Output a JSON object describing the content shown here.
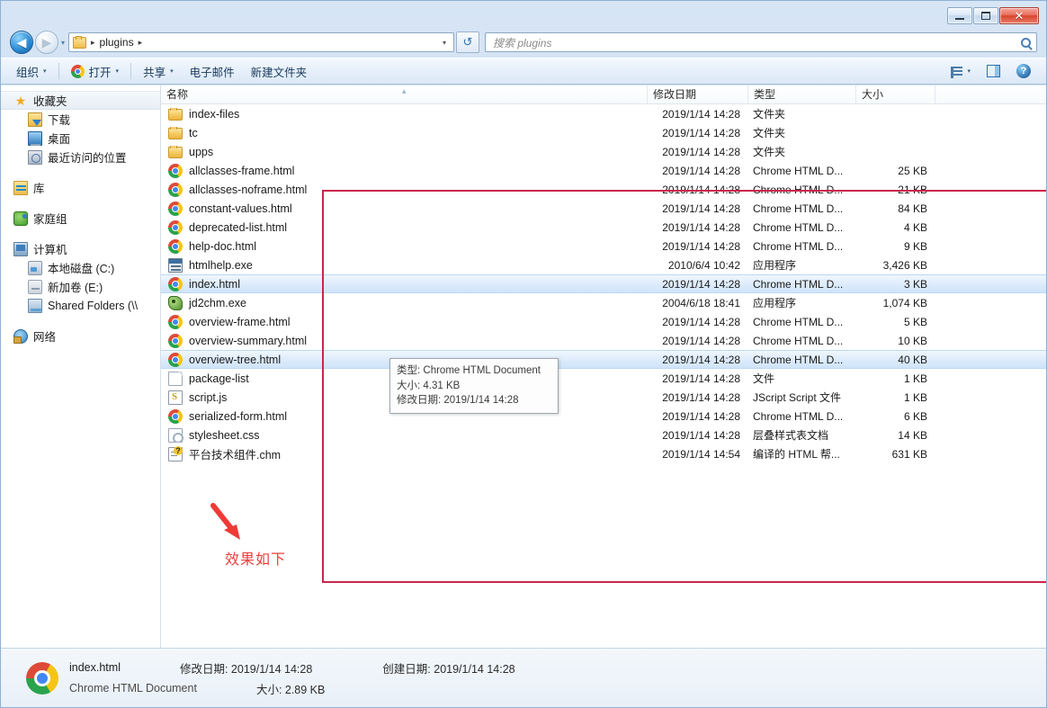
{
  "window": {
    "minimize_label": "–",
    "maximize_label": "□",
    "close_label": "✕"
  },
  "address": {
    "back_glyph": "◀",
    "forward_glyph": "▶",
    "history_glyph": "▾",
    "crumb": "plugins",
    "crumb_sep": "▸",
    "dropdown_glyph": "▾",
    "refresh_glyph": "↺"
  },
  "search": {
    "placeholder": "搜索 plugins"
  },
  "toolbar": {
    "organize": "组织",
    "open": "打开",
    "share": "共享",
    "email": "电子邮件",
    "new_folder": "新建文件夹",
    "caret": "▾",
    "help_glyph": "?"
  },
  "sidebar": {
    "items": [
      {
        "label": "收藏夹",
        "icon": "star-icon",
        "level": 0,
        "selected": true
      },
      {
        "label": "下载",
        "icon": "downloads-icon",
        "level": 1,
        "selected": false
      },
      {
        "label": "桌面",
        "icon": "desktop-icon",
        "level": 1,
        "selected": false
      },
      {
        "label": "最近访问的位置",
        "icon": "recent-places-icon",
        "level": 1,
        "selected": false
      },
      {
        "label": "库",
        "icon": "library-icon",
        "level": 0,
        "selected": false,
        "gap_before": true
      },
      {
        "label": "家庭组",
        "icon": "homegroup-icon",
        "level": 0,
        "selected": false,
        "gap_before": true
      },
      {
        "label": "计算机",
        "icon": "computer-icon",
        "level": 0,
        "selected": false,
        "gap_before": true
      },
      {
        "label": "本地磁盘 (C:)",
        "icon": "hard-disk-icon",
        "level": 1,
        "selected": false
      },
      {
        "label": "新加卷 (E:)",
        "icon": "drive-icon",
        "level": 1,
        "selected": false
      },
      {
        "label": "Shared Folders (\\\\",
        "icon": "shared-folder-icon",
        "level": 1,
        "selected": false
      },
      {
        "label": "网络",
        "icon": "network-icon",
        "level": 0,
        "selected": false,
        "gap_before": true
      }
    ]
  },
  "filelist": {
    "columns": {
      "name": "名称",
      "date": "修改日期",
      "type": "类型",
      "size": "大小"
    },
    "sort_caret": "▴",
    "rows": [
      {
        "name": "index-files",
        "date": "2019/1/14 14:28",
        "type": "文件夹",
        "size": "",
        "icon": "folder-icon",
        "selected": false
      },
      {
        "name": "tc",
        "date": "2019/1/14 14:28",
        "type": "文件夹",
        "size": "",
        "icon": "folder-icon",
        "selected": false
      },
      {
        "name": "upps",
        "date": "2019/1/14 14:28",
        "type": "文件夹",
        "size": "",
        "icon": "folder-icon",
        "selected": false
      },
      {
        "name": "allclasses-frame.html",
        "date": "2019/1/14 14:28",
        "type": "Chrome HTML D...",
        "size": "25 KB",
        "icon": "chrome-icon",
        "selected": false
      },
      {
        "name": "allclasses-noframe.html",
        "date": "2019/1/14 14:28",
        "type": "Chrome HTML D...",
        "size": "21 KB",
        "icon": "chrome-icon",
        "selected": false
      },
      {
        "name": "constant-values.html",
        "date": "2019/1/14 14:28",
        "type": "Chrome HTML D...",
        "size": "84 KB",
        "icon": "chrome-icon",
        "selected": false
      },
      {
        "name": "deprecated-list.html",
        "date": "2019/1/14 14:28",
        "type": "Chrome HTML D...",
        "size": "4 KB",
        "icon": "chrome-icon",
        "selected": false
      },
      {
        "name": "help-doc.html",
        "date": "2019/1/14 14:28",
        "type": "Chrome HTML D...",
        "size": "9 KB",
        "icon": "chrome-icon",
        "selected": false
      },
      {
        "name": "htmlhelp.exe",
        "date": "2010/6/4 10:42",
        "type": "应用程序",
        "size": "3,426 KB",
        "icon": "application-icon",
        "selected": false
      },
      {
        "name": "index.html",
        "date": "2019/1/14 14:28",
        "type": "Chrome HTML D...",
        "size": "3 KB",
        "icon": "chrome-icon",
        "selected": true
      },
      {
        "name": "jd2chm.exe",
        "date": "2004/6/18 18:41",
        "type": "应用程序",
        "size": "1,074 KB",
        "icon": "snake-application-icon",
        "selected": false
      },
      {
        "name": "overview-frame.html",
        "date": "2019/1/14 14:28",
        "type": "Chrome HTML D...",
        "size": "5 KB",
        "icon": "chrome-icon",
        "selected": false
      },
      {
        "name": "overview-summary.html",
        "date": "2019/1/14 14:28",
        "type": "Chrome HTML D...",
        "size": "10 KB",
        "icon": "chrome-icon",
        "selected": false
      },
      {
        "name": "overview-tree.html",
        "date": "2019/1/14 14:28",
        "type": "Chrome HTML D...",
        "size": "40 KB",
        "icon": "chrome-icon",
        "selected": true
      },
      {
        "name": "package-list",
        "date": "2019/1/14 14:28",
        "type": "文件",
        "size": "1 KB",
        "icon": "generic-file-icon",
        "selected": false
      },
      {
        "name": "script.js",
        "date": "2019/1/14 14:28",
        "type": "JScript Script 文件",
        "size": "1 KB",
        "icon": "jscript-icon",
        "selected": false
      },
      {
        "name": "serialized-form.html",
        "date": "2019/1/14 14:28",
        "type": "Chrome HTML D...",
        "size": "6 KB",
        "icon": "chrome-icon",
        "selected": false
      },
      {
        "name": "stylesheet.css",
        "date": "2019/1/14 14:28",
        "type": "层叠样式表文档",
        "size": "14 KB",
        "icon": "css-icon",
        "selected": false
      },
      {
        "name": "平台技术组件.chm",
        "date": "2019/1/14 14:54",
        "type": "编译的 HTML 帮...",
        "size": "631 KB",
        "icon": "chm-icon",
        "selected": false
      }
    ]
  },
  "tooltip": {
    "type_line": "类型: Chrome HTML Document",
    "size_line": "大小: 4.31 KB",
    "date_line": "修改日期: 2019/1/14 14:28"
  },
  "annotation": {
    "caption": "效果如下",
    "color": "#e8413c",
    "box_color": "#c9264b"
  },
  "statusbar": {
    "file_name": "index.html",
    "file_type": "Chrome HTML Document",
    "modified_label": "修改日期: 2019/1/14 14:28",
    "created_label": "创建日期: 2019/1/14 14:28",
    "size_label": "大小: 2.89 KB"
  }
}
